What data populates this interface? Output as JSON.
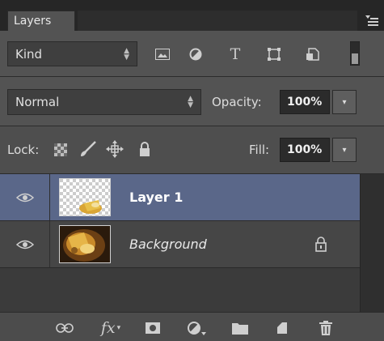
{
  "panel": {
    "tab_label": "Layers"
  },
  "filter": {
    "kind_label": "Kind"
  },
  "blend": {
    "mode_value": "Normal",
    "opacity_label": "Opacity:",
    "opacity_value": "100%"
  },
  "lock": {
    "lock_label": "Lock:",
    "fill_label": "Fill:",
    "fill_value": "100%"
  },
  "layers": [
    {
      "name": "Layer 1",
      "visible": true,
      "selected": true
    },
    {
      "name": "Background",
      "visible": true,
      "locked": true
    }
  ],
  "bottom": {
    "fx_label": "fx"
  },
  "colors": {
    "panel_bg": "#535353",
    "selection": "#5a6789",
    "field_bg": "#2b2b2b"
  }
}
